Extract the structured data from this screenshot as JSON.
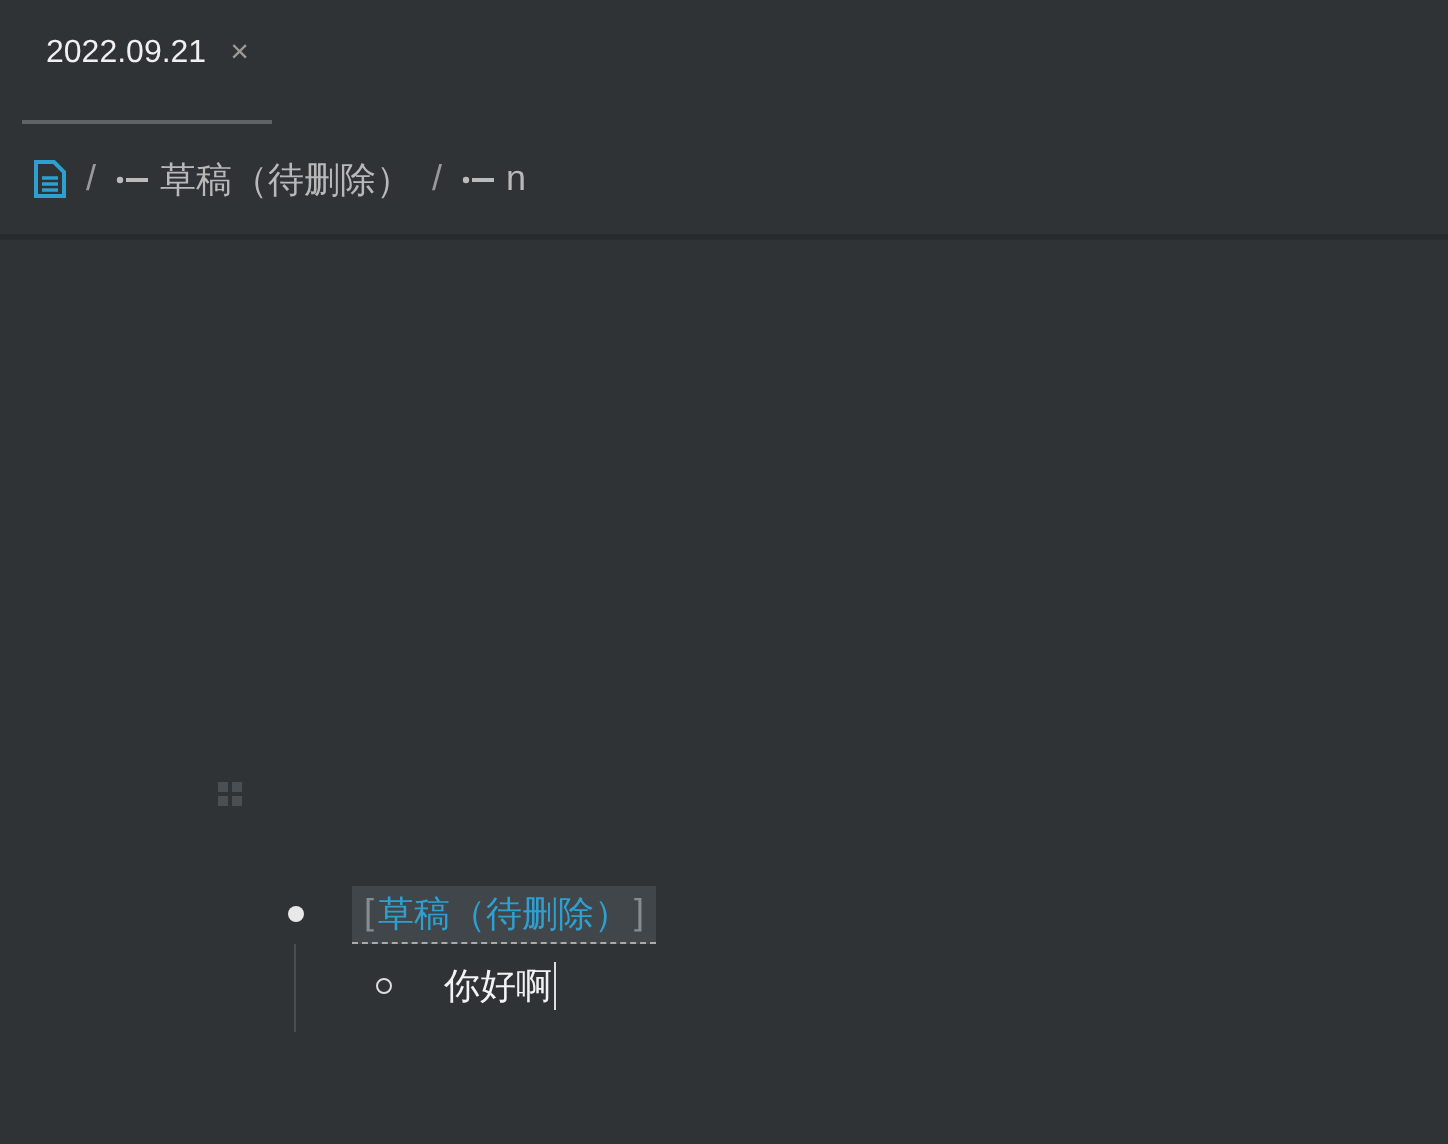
{
  "tabs": [
    {
      "label": "2022.09.21",
      "close": "×",
      "selected": true
    }
  ],
  "breadcrumb": [
    {
      "kind": "doc"
    },
    {
      "kind": "block",
      "text": "草稿（待删除）"
    },
    {
      "kind": "block",
      "text": "n"
    }
  ],
  "breadcrumb_separator": "/",
  "blocks": [
    {
      "kind": "ref",
      "open": "[",
      "text": "草稿（待删除）",
      "close": "]",
      "children": [
        {
          "kind": "text",
          "text": "你好啊",
          "editing": true
        }
      ]
    }
  ]
}
